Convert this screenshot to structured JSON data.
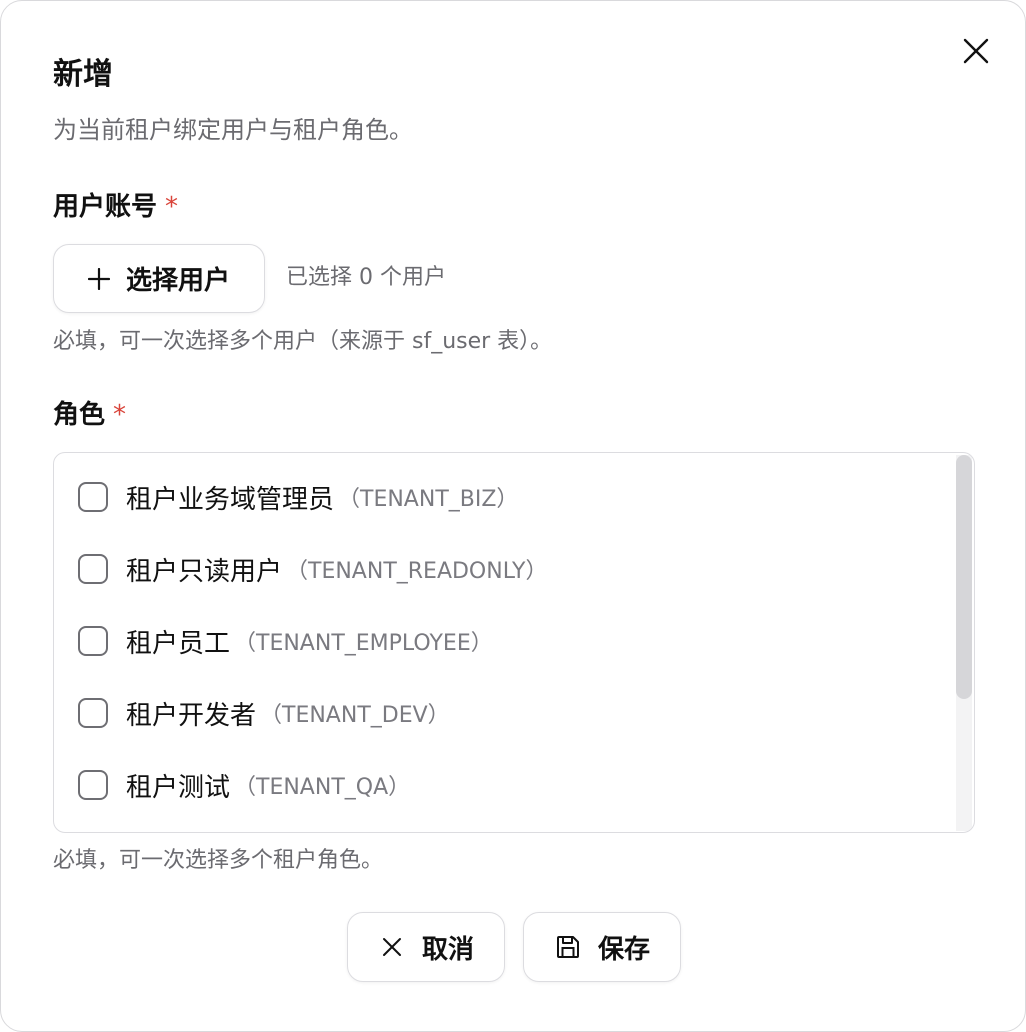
{
  "dialog": {
    "title": "新增",
    "subtitle": "为当前租户绑定用户与租户角色。"
  },
  "user_field": {
    "label": "用户账号",
    "required_mark": "*",
    "select_button_label": "选择用户",
    "selected_text": "已选择 0 个用户",
    "help": "必填，可一次选择多个用户（来源于 sf_user 表）。"
  },
  "role_field": {
    "label": "角色",
    "required_mark": "*",
    "help": "必填，可一次选择多个租户角色。",
    "options": [
      {
        "name": "租户业务域管理员",
        "code": "（TENANT_BIZ）",
        "checked": false
      },
      {
        "name": "租户只读用户",
        "code": "（TENANT_READONLY）",
        "checked": false
      },
      {
        "name": "租户员工",
        "code": "（TENANT_EMPLOYEE）",
        "checked": false
      },
      {
        "name": "租户开发者",
        "code": "（TENANT_DEV）",
        "checked": false
      },
      {
        "name": "租户测试",
        "code": "（TENANT_QA）",
        "checked": false
      }
    ]
  },
  "footer": {
    "cancel_label": "取消",
    "save_label": "保存"
  },
  "icons": {
    "close": "close-icon",
    "plus": "plus-icon",
    "cancel": "x-icon",
    "save": "save-icon"
  },
  "colors": {
    "required": "#d9443a",
    "text_primary": "#111111",
    "text_secondary": "#6b6b70"
  }
}
